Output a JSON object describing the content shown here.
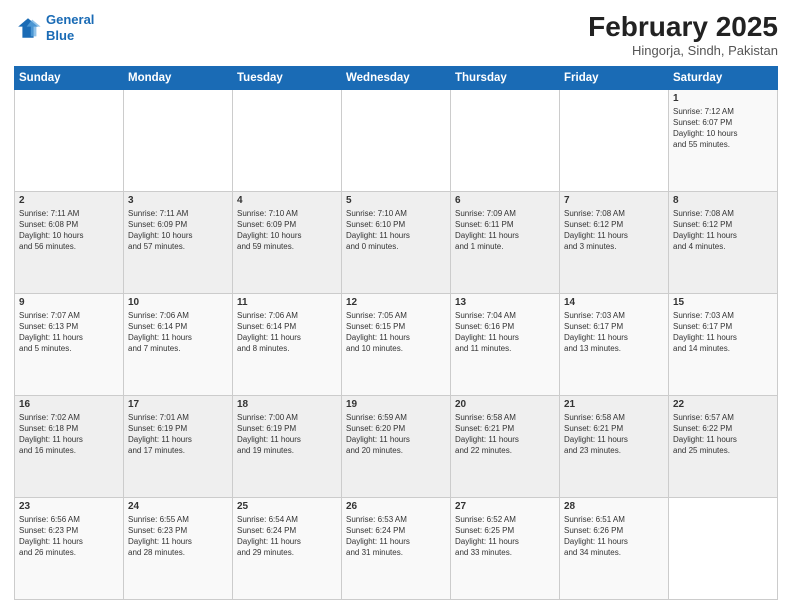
{
  "header": {
    "logo_line1": "General",
    "logo_line2": "Blue",
    "month": "February 2025",
    "location": "Hingorja, Sindh, Pakistan"
  },
  "weekdays": [
    "Sunday",
    "Monday",
    "Tuesday",
    "Wednesday",
    "Thursday",
    "Friday",
    "Saturday"
  ],
  "weeks": [
    [
      {
        "day": "",
        "info": ""
      },
      {
        "day": "",
        "info": ""
      },
      {
        "day": "",
        "info": ""
      },
      {
        "day": "",
        "info": ""
      },
      {
        "day": "",
        "info": ""
      },
      {
        "day": "",
        "info": ""
      },
      {
        "day": "1",
        "info": "Sunrise: 7:12 AM\nSunset: 6:07 PM\nDaylight: 10 hours\nand 55 minutes."
      }
    ],
    [
      {
        "day": "2",
        "info": "Sunrise: 7:11 AM\nSunset: 6:08 PM\nDaylight: 10 hours\nand 56 minutes."
      },
      {
        "day": "3",
        "info": "Sunrise: 7:11 AM\nSunset: 6:09 PM\nDaylight: 10 hours\nand 57 minutes."
      },
      {
        "day": "4",
        "info": "Sunrise: 7:10 AM\nSunset: 6:09 PM\nDaylight: 10 hours\nand 59 minutes."
      },
      {
        "day": "5",
        "info": "Sunrise: 7:10 AM\nSunset: 6:10 PM\nDaylight: 11 hours\nand 0 minutes."
      },
      {
        "day": "6",
        "info": "Sunrise: 7:09 AM\nSunset: 6:11 PM\nDaylight: 11 hours\nand 1 minute."
      },
      {
        "day": "7",
        "info": "Sunrise: 7:08 AM\nSunset: 6:12 PM\nDaylight: 11 hours\nand 3 minutes."
      },
      {
        "day": "8",
        "info": "Sunrise: 7:08 AM\nSunset: 6:12 PM\nDaylight: 11 hours\nand 4 minutes."
      }
    ],
    [
      {
        "day": "9",
        "info": "Sunrise: 7:07 AM\nSunset: 6:13 PM\nDaylight: 11 hours\nand 5 minutes."
      },
      {
        "day": "10",
        "info": "Sunrise: 7:06 AM\nSunset: 6:14 PM\nDaylight: 11 hours\nand 7 minutes."
      },
      {
        "day": "11",
        "info": "Sunrise: 7:06 AM\nSunset: 6:14 PM\nDaylight: 11 hours\nand 8 minutes."
      },
      {
        "day": "12",
        "info": "Sunrise: 7:05 AM\nSunset: 6:15 PM\nDaylight: 11 hours\nand 10 minutes."
      },
      {
        "day": "13",
        "info": "Sunrise: 7:04 AM\nSunset: 6:16 PM\nDaylight: 11 hours\nand 11 minutes."
      },
      {
        "day": "14",
        "info": "Sunrise: 7:03 AM\nSunset: 6:17 PM\nDaylight: 11 hours\nand 13 minutes."
      },
      {
        "day": "15",
        "info": "Sunrise: 7:03 AM\nSunset: 6:17 PM\nDaylight: 11 hours\nand 14 minutes."
      }
    ],
    [
      {
        "day": "16",
        "info": "Sunrise: 7:02 AM\nSunset: 6:18 PM\nDaylight: 11 hours\nand 16 minutes."
      },
      {
        "day": "17",
        "info": "Sunrise: 7:01 AM\nSunset: 6:19 PM\nDaylight: 11 hours\nand 17 minutes."
      },
      {
        "day": "18",
        "info": "Sunrise: 7:00 AM\nSunset: 6:19 PM\nDaylight: 11 hours\nand 19 minutes."
      },
      {
        "day": "19",
        "info": "Sunrise: 6:59 AM\nSunset: 6:20 PM\nDaylight: 11 hours\nand 20 minutes."
      },
      {
        "day": "20",
        "info": "Sunrise: 6:58 AM\nSunset: 6:21 PM\nDaylight: 11 hours\nand 22 minutes."
      },
      {
        "day": "21",
        "info": "Sunrise: 6:58 AM\nSunset: 6:21 PM\nDaylight: 11 hours\nand 23 minutes."
      },
      {
        "day": "22",
        "info": "Sunrise: 6:57 AM\nSunset: 6:22 PM\nDaylight: 11 hours\nand 25 minutes."
      }
    ],
    [
      {
        "day": "23",
        "info": "Sunrise: 6:56 AM\nSunset: 6:23 PM\nDaylight: 11 hours\nand 26 minutes."
      },
      {
        "day": "24",
        "info": "Sunrise: 6:55 AM\nSunset: 6:23 PM\nDaylight: 11 hours\nand 28 minutes."
      },
      {
        "day": "25",
        "info": "Sunrise: 6:54 AM\nSunset: 6:24 PM\nDaylight: 11 hours\nand 29 minutes."
      },
      {
        "day": "26",
        "info": "Sunrise: 6:53 AM\nSunset: 6:24 PM\nDaylight: 11 hours\nand 31 minutes."
      },
      {
        "day": "27",
        "info": "Sunrise: 6:52 AM\nSunset: 6:25 PM\nDaylight: 11 hours\nand 33 minutes."
      },
      {
        "day": "28",
        "info": "Sunrise: 6:51 AM\nSunset: 6:26 PM\nDaylight: 11 hours\nand 34 minutes."
      },
      {
        "day": "",
        "info": ""
      }
    ]
  ]
}
